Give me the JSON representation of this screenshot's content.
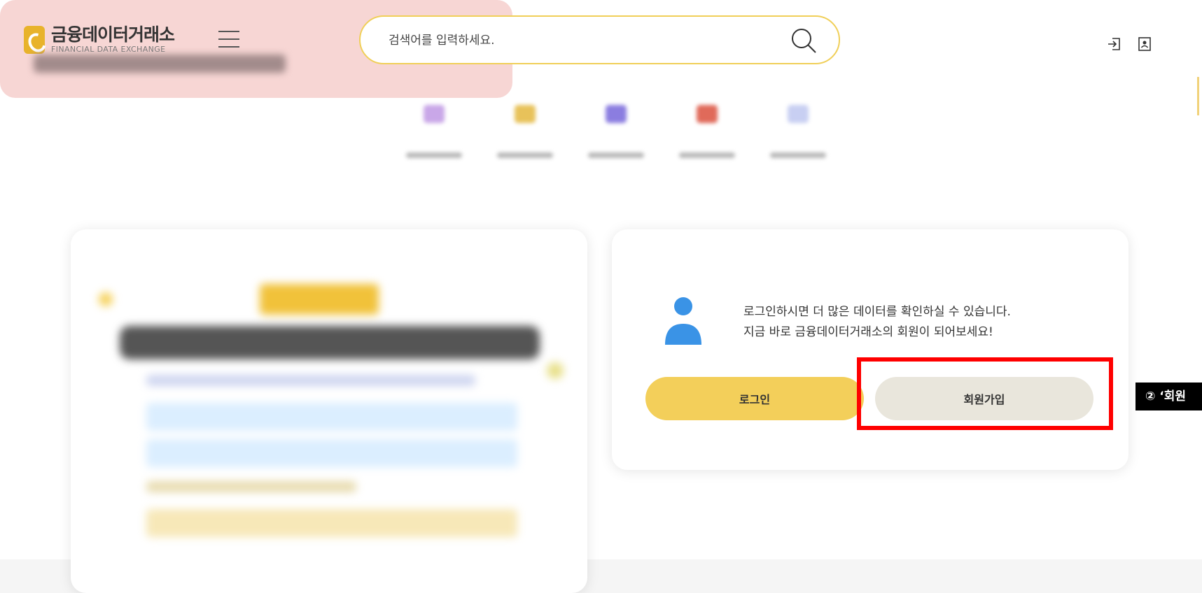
{
  "header": {
    "logo_ko": "금융데이터거래소",
    "logo_en": "FINANCIAL DATA EXCHANGE",
    "search_placeholder": "검색어를 입력하세요."
  },
  "login_card": {
    "message_line1": "로그인하시면 더 많은 데이터를 확인하실 수 있습니다.",
    "message_line2": "지금 바로 금융데이터거래소의 회원이 되어보세요!",
    "login_button": "로그인",
    "join_button": "회원가입"
  },
  "annotation": {
    "callout_text": "② ‘회원"
  },
  "colors": {
    "accent_yellow": "#f3cf5a",
    "search_border": "#f0cf58",
    "highlight_red": "#ff0000",
    "join_bg": "#e9e6dc",
    "pink_card": "#f7d6d4"
  },
  "icons": [
    "hamburger-icon",
    "search-icon",
    "login-icon",
    "account-icon",
    "user-avatar-icon"
  ]
}
